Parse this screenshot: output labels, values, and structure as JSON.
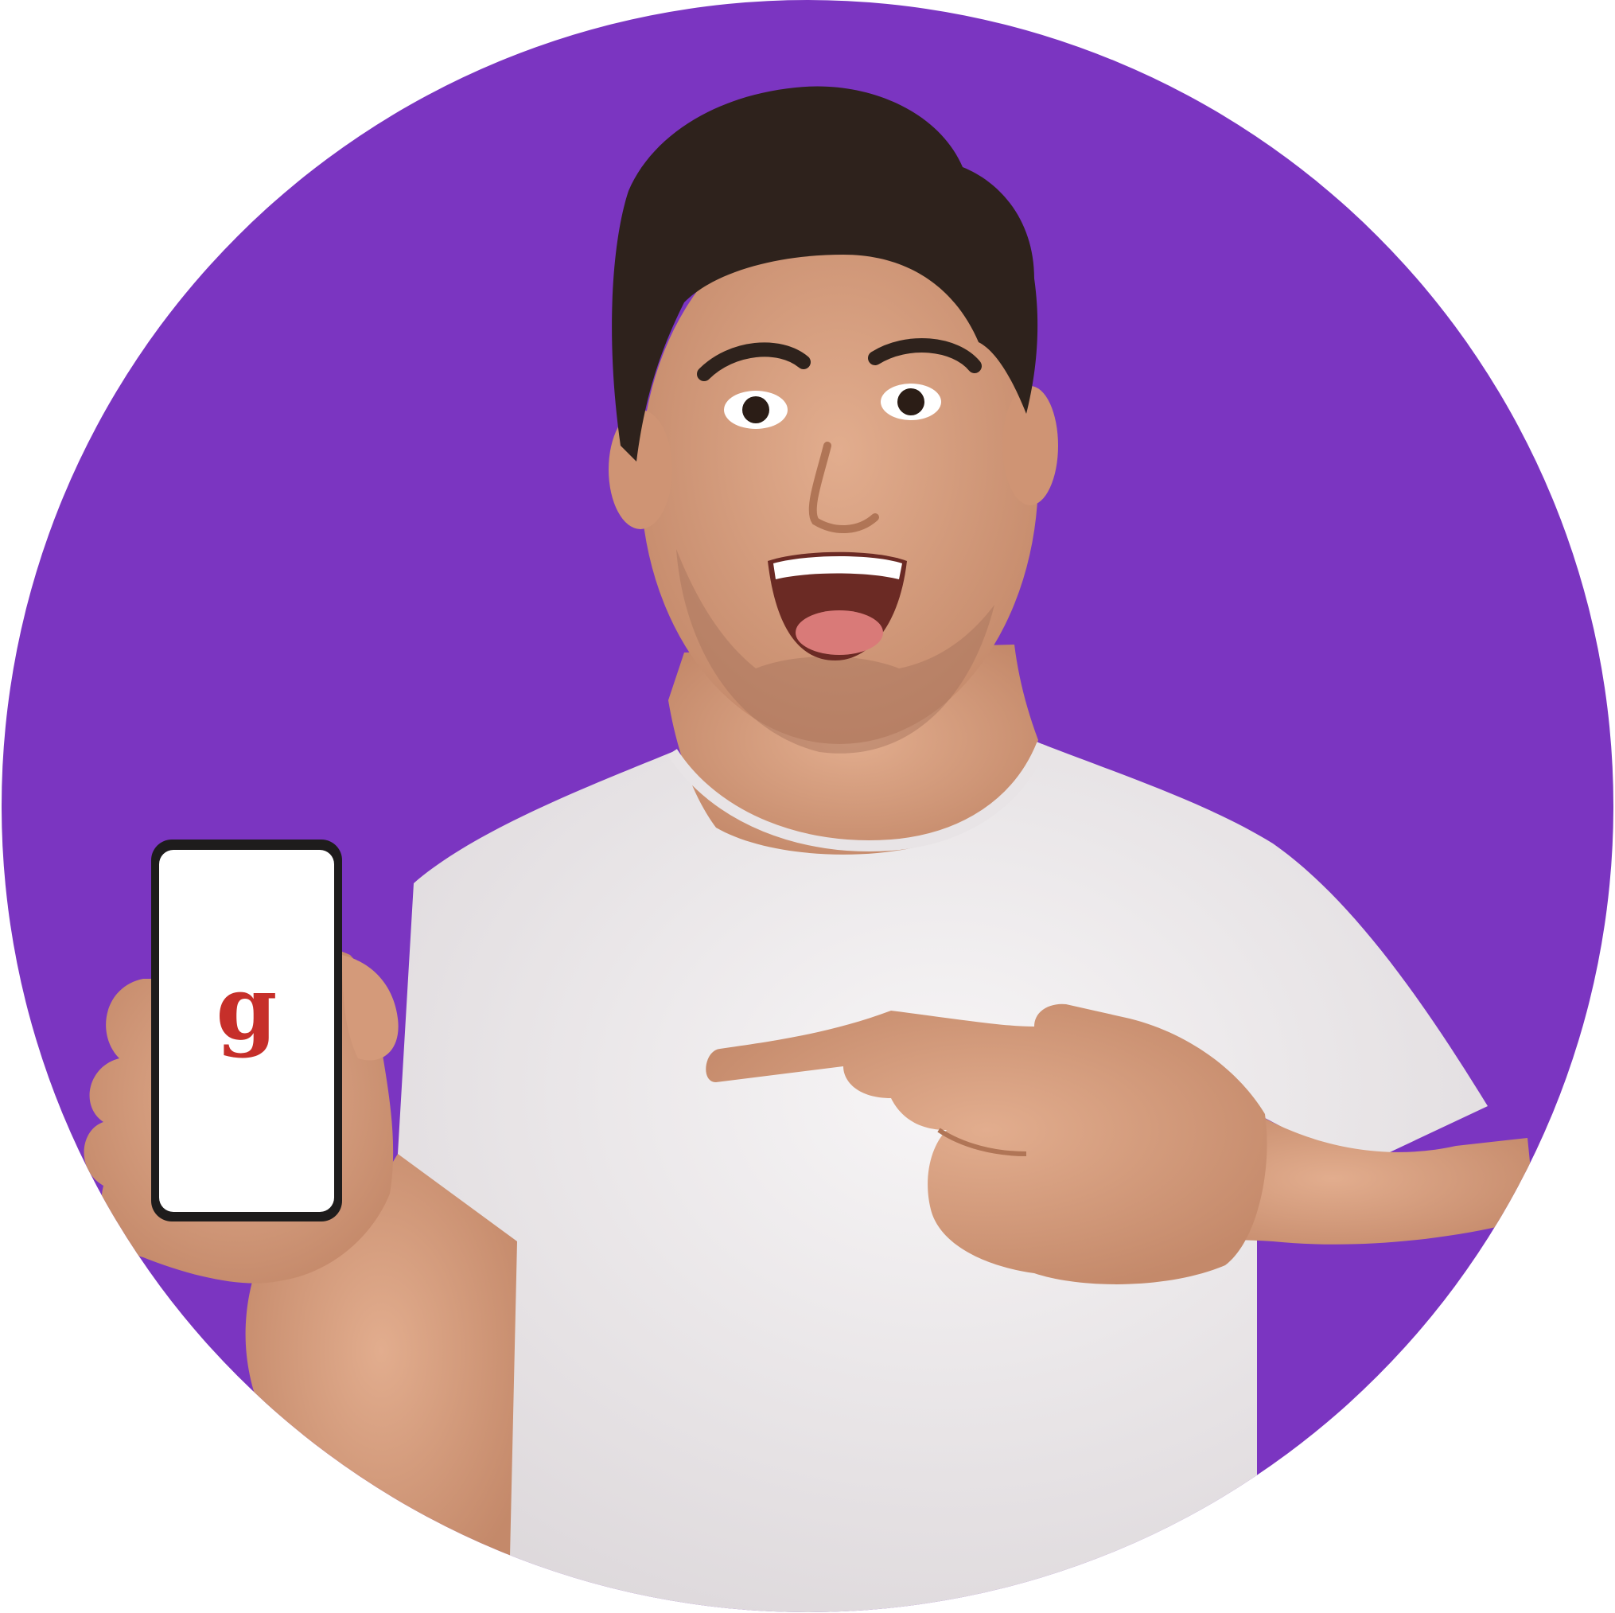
{
  "image": {
    "kind": "circular-avatar-photo",
    "subject": "man-holding-smartphone-pointing",
    "colors": {
      "background_page": "#ffffff",
      "circle_fill": "#7b35c1",
      "shirt": "#f2eff0",
      "skin": "#d9a07f",
      "hair": "#2e221c",
      "phone_frame": "#1e1c1c",
      "phone_screen": "#ffffff",
      "logo_red": "#c62f2a"
    }
  },
  "phone": {
    "logo_letter": "g",
    "logo_icon": "app-logo-g-icon"
  }
}
